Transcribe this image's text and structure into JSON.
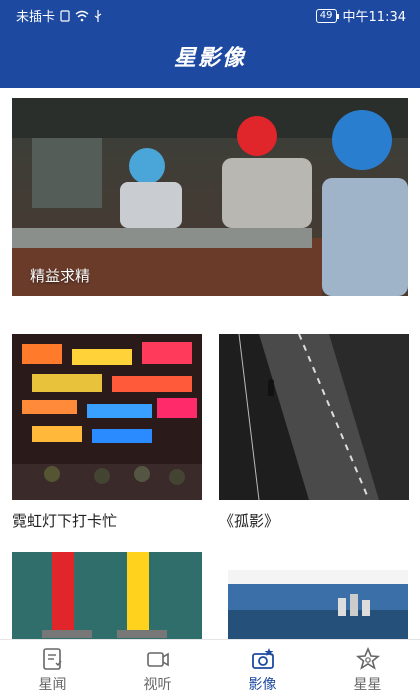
{
  "status_bar": {
    "carrier": "未插卡",
    "battery": "49",
    "clock": "中午11:34"
  },
  "header": {
    "title": "星影像"
  },
  "feed": {
    "hero": {
      "label": "精益求精"
    },
    "tiles": [
      {
        "caption": "霓虹灯下打卡忙"
      },
      {
        "caption": "《孤影》"
      },
      {
        "caption": ""
      },
      {
        "caption": ""
      }
    ]
  },
  "bottom_nav": {
    "items": [
      {
        "label": "星闻",
        "icon": "news-icon"
      },
      {
        "label": "视听",
        "icon": "video-icon"
      },
      {
        "label": "影像",
        "icon": "camera-icon",
        "active": true
      },
      {
        "label": "星星",
        "icon": "star-icon"
      }
    ]
  },
  "colors": {
    "brand": "#1d4aa0",
    "inactive": "#666666"
  }
}
